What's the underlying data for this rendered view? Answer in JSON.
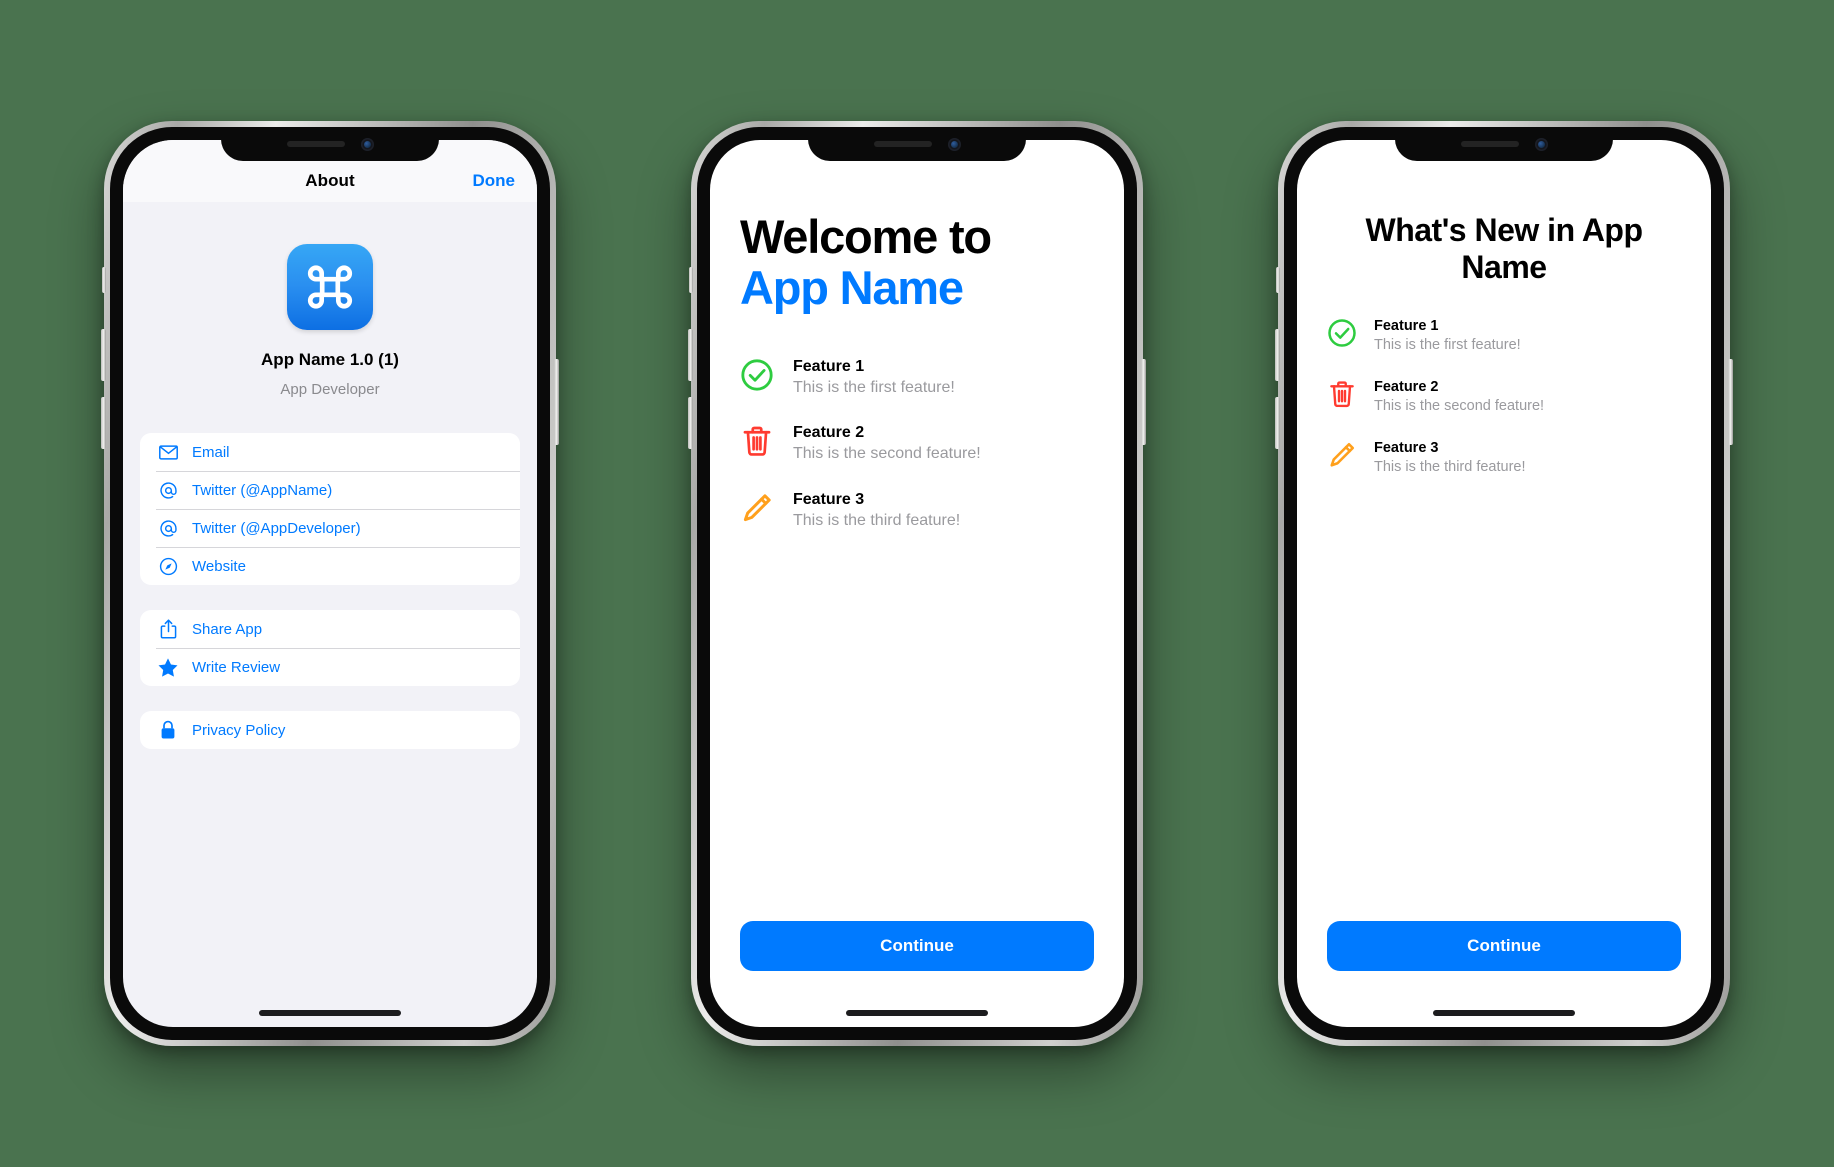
{
  "background_color": "#4a734f",
  "accent_color": "#007aff",
  "phones": {
    "about": {
      "nav": {
        "title": "About",
        "done_label": "Done"
      },
      "app_icon_name": "command-icon",
      "app_title": "App Name 1.0 (1)",
      "app_developer": "App Developer",
      "groups": [
        {
          "rows": [
            {
              "icon": "envelope-icon",
              "label": "Email"
            },
            {
              "icon": "at-sign-icon",
              "label": "Twitter (@AppName)"
            },
            {
              "icon": "at-sign-icon",
              "label": "Twitter (@AppDeveloper)"
            },
            {
              "icon": "compass-icon",
              "label": "Website"
            }
          ]
        },
        {
          "rows": [
            {
              "icon": "share-icon",
              "label": "Share App"
            },
            {
              "icon": "star-icon",
              "label": "Write Review"
            }
          ]
        },
        {
          "rows": [
            {
              "icon": "lock-icon",
              "label": "Privacy Policy"
            }
          ]
        }
      ]
    },
    "welcome": {
      "heading_line1": "Welcome to",
      "heading_line2": "App Name",
      "features": [
        {
          "icon": "checkmark-circle-icon",
          "icon_color": "#2ecc40",
          "title": "Feature 1",
          "desc": "This is the first feature!"
        },
        {
          "icon": "trash-icon",
          "icon_color": "#ff3b30",
          "title": "Feature 2",
          "desc": "This is the second feature!"
        },
        {
          "icon": "pencil-icon",
          "icon_color": "#ffa01c",
          "title": "Feature 3",
          "desc": "This is the third feature!"
        }
      ],
      "continue_label": "Continue"
    },
    "whats_new": {
      "heading": "What's New in App Name",
      "features": [
        {
          "icon": "checkmark-circle-icon",
          "icon_color": "#2ecc40",
          "title": "Feature 1",
          "desc": "This is the first feature!"
        },
        {
          "icon": "trash-icon",
          "icon_color": "#ff3b30",
          "title": "Feature 2",
          "desc": "This is the second feature!"
        },
        {
          "icon": "pencil-icon",
          "icon_color": "#ffa01c",
          "title": "Feature 3",
          "desc": "This is the third feature!"
        }
      ],
      "continue_label": "Continue"
    }
  }
}
